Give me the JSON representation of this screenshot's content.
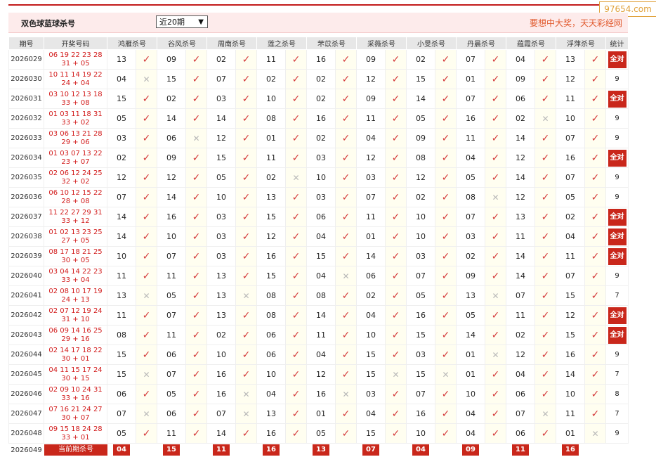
{
  "watermark": "97654.com",
  "header": {
    "title": "双色球蓝球杀号",
    "period_select": "近20期",
    "slogan": "要想中大奖，天天彩经网"
  },
  "columns": {
    "issue": "期号",
    "draw": "开奖号码",
    "experts": [
      "鸿雁杀号",
      "谷风杀号",
      "周南杀号",
      "莲之杀号",
      "芣苡杀号",
      "采薇杀号",
      "小旻杀号",
      "丹晨杀号",
      "蕴霞杀号",
      "浮萍杀号"
    ],
    "stat": "统计"
  },
  "all_correct_label": "全对",
  "rows": [
    {
      "issue": "2026029",
      "red": "06 19 22 23 28",
      "tail": "31 + 05",
      "kills": [
        "13",
        "09",
        "02",
        "11",
        "16",
        "09",
        "02",
        "07",
        "04",
        "13"
      ],
      "hits": [
        1,
        1,
        1,
        1,
        1,
        1,
        1,
        1,
        1,
        1
      ],
      "stat": "全对"
    },
    {
      "issue": "2026030",
      "red": "10 11 14 19 22",
      "tail": "24 + 04",
      "kills": [
        "04",
        "15",
        "07",
        "02",
        "02",
        "12",
        "15",
        "01",
        "09",
        "12"
      ],
      "hits": [
        0,
        1,
        1,
        1,
        1,
        1,
        1,
        1,
        1,
        1
      ],
      "stat": "9"
    },
    {
      "issue": "2026031",
      "red": "03 10 12 13 18",
      "tail": "33 + 08",
      "kills": [
        "15",
        "02",
        "03",
        "10",
        "02",
        "09",
        "14",
        "07",
        "06",
        "11"
      ],
      "hits": [
        1,
        1,
        1,
        1,
        1,
        1,
        1,
        1,
        1,
        1
      ],
      "stat": "全对"
    },
    {
      "issue": "2026032",
      "red": "01 03 11 18 31",
      "tail": "33 + 02",
      "kills": [
        "05",
        "14",
        "14",
        "08",
        "16",
        "11",
        "05",
        "16",
        "02",
        "10"
      ],
      "hits": [
        1,
        1,
        1,
        1,
        1,
        1,
        1,
        1,
        0,
        1
      ],
      "stat": "9"
    },
    {
      "issue": "2026033",
      "red": "03 06 13 21 28",
      "tail": "29 + 06",
      "kills": [
        "03",
        "06",
        "12",
        "01",
        "02",
        "04",
        "09",
        "11",
        "14",
        "07"
      ],
      "hits": [
        1,
        0,
        1,
        1,
        1,
        1,
        1,
        1,
        1,
        1
      ],
      "stat": "9"
    },
    {
      "issue": "2026034",
      "red": "01 03 07 13 22",
      "tail": "23 + 07",
      "kills": [
        "02",
        "09",
        "15",
        "11",
        "03",
        "12",
        "08",
        "04",
        "12",
        "16"
      ],
      "hits": [
        1,
        1,
        1,
        1,
        1,
        1,
        1,
        1,
        1,
        1
      ],
      "stat": "全对"
    },
    {
      "issue": "2026035",
      "red": "02 06 12 24 25",
      "tail": "32 + 02",
      "kills": [
        "12",
        "12",
        "05",
        "02",
        "10",
        "03",
        "12",
        "05",
        "14",
        "07"
      ],
      "hits": [
        1,
        1,
        1,
        0,
        1,
        1,
        1,
        1,
        1,
        1
      ],
      "stat": "9"
    },
    {
      "issue": "2026036",
      "red": "06 10 12 15 22",
      "tail": "28 + 08",
      "kills": [
        "07",
        "14",
        "10",
        "13",
        "03",
        "07",
        "02",
        "08",
        "12",
        "05"
      ],
      "hits": [
        1,
        1,
        1,
        1,
        1,
        1,
        1,
        0,
        1,
        1
      ],
      "stat": "9"
    },
    {
      "issue": "2026037",
      "red": "11 22 27 29 31",
      "tail": "33 + 12",
      "kills": [
        "14",
        "16",
        "03",
        "15",
        "06",
        "11",
        "10",
        "07",
        "13",
        "02"
      ],
      "hits": [
        1,
        1,
        1,
        1,
        1,
        1,
        1,
        1,
        1,
        1
      ],
      "stat": "全对"
    },
    {
      "issue": "2026038",
      "red": "01 02 13 23 25",
      "tail": "27 + 05",
      "kills": [
        "14",
        "10",
        "03",
        "12",
        "04",
        "01",
        "10",
        "03",
        "11",
        "04"
      ],
      "hits": [
        1,
        1,
        1,
        1,
        1,
        1,
        1,
        1,
        1,
        1
      ],
      "stat": "全对"
    },
    {
      "issue": "2026039",
      "red": "08 17 18 21 25",
      "tail": "30 + 05",
      "kills": [
        "10",
        "07",
        "03",
        "16",
        "15",
        "14",
        "03",
        "02",
        "14",
        "11"
      ],
      "hits": [
        1,
        1,
        1,
        1,
        1,
        1,
        1,
        1,
        1,
        1
      ],
      "stat": "全对"
    },
    {
      "issue": "2026040",
      "red": "03 04 14 22 23",
      "tail": "33 + 04",
      "kills": [
        "11",
        "11",
        "13",
        "15",
        "04",
        "06",
        "07",
        "09",
        "14",
        "07"
      ],
      "hits": [
        1,
        1,
        1,
        1,
        0,
        1,
        1,
        1,
        1,
        1
      ],
      "stat": "9"
    },
    {
      "issue": "2026041",
      "red": "02 08 10 17 19",
      "tail": "24 + 13",
      "kills": [
        "13",
        "05",
        "13",
        "08",
        "08",
        "02",
        "05",
        "13",
        "07",
        "15"
      ],
      "hits": [
        0,
        1,
        0,
        1,
        1,
        1,
        1,
        0,
        1,
        1
      ],
      "stat": "7"
    },
    {
      "issue": "2026042",
      "red": "02 07 12 19 24",
      "tail": "31 + 10",
      "kills": [
        "11",
        "07",
        "13",
        "08",
        "14",
        "04",
        "16",
        "05",
        "11",
        "12"
      ],
      "hits": [
        1,
        1,
        1,
        1,
        1,
        1,
        1,
        1,
        1,
        1
      ],
      "stat": "全对"
    },
    {
      "issue": "2026043",
      "red": "06 09 14 16 25",
      "tail": "29 + 16",
      "kills": [
        "08",
        "11",
        "02",
        "06",
        "11",
        "10",
        "15",
        "14",
        "02",
        "15"
      ],
      "hits": [
        1,
        1,
        1,
        1,
        1,
        1,
        1,
        1,
        1,
        1
      ],
      "stat": "全对"
    },
    {
      "issue": "2026044",
      "red": "02 14 17 18 22",
      "tail": "30 + 01",
      "kills": [
        "15",
        "06",
        "10",
        "06",
        "04",
        "15",
        "03",
        "01",
        "12",
        "16"
      ],
      "hits": [
        1,
        1,
        1,
        1,
        1,
        1,
        1,
        0,
        1,
        1
      ],
      "stat": "9"
    },
    {
      "issue": "2026045",
      "red": "04 11 15 17 24",
      "tail": "30 + 15",
      "kills": [
        "15",
        "07",
        "16",
        "10",
        "12",
        "15",
        "15",
        "01",
        "04",
        "14"
      ],
      "hits": [
        0,
        1,
        1,
        1,
        1,
        0,
        0,
        1,
        1,
        1
      ],
      "stat": "7"
    },
    {
      "issue": "2026046",
      "red": "02 09 10 24 31",
      "tail": "33 + 16",
      "kills": [
        "06",
        "05",
        "16",
        "04",
        "16",
        "03",
        "07",
        "10",
        "06",
        "10"
      ],
      "hits": [
        1,
        1,
        0,
        1,
        0,
        1,
        1,
        1,
        1,
        1
      ],
      "stat": "8"
    },
    {
      "issue": "2026047",
      "red": "07 16 21 24 27",
      "tail": "30 + 07",
      "kills": [
        "07",
        "06",
        "07",
        "13",
        "01",
        "04",
        "16",
        "04",
        "07",
        "11"
      ],
      "hits": [
        0,
        1,
        0,
        1,
        1,
        1,
        1,
        1,
        0,
        1
      ],
      "stat": "7"
    },
    {
      "issue": "2026048",
      "red": "09 15 18 24 28",
      "tail": "33 + 01",
      "kills": [
        "05",
        "11",
        "14",
        "16",
        "05",
        "15",
        "10",
        "04",
        "06",
        "01"
      ],
      "hits": [
        1,
        1,
        1,
        1,
        1,
        1,
        1,
        1,
        1,
        0
      ],
      "stat": "9"
    }
  ],
  "current": {
    "issue": "2026049",
    "label": "当前期杀号",
    "kills": [
      "04",
      "15",
      "11",
      "16",
      "13",
      "07",
      "04",
      "09",
      "11",
      "16"
    ]
  },
  "icons": {
    "hit": "check-icon",
    "miss": "cross-icon"
  },
  "colors": {
    "accent": "#c9271b",
    "hit": "#d43b3b",
    "miss": "#b8b8b8",
    "draw": "#d21b1b",
    "header_bg": "#fdebeb",
    "slogan": "#e0582b"
  }
}
